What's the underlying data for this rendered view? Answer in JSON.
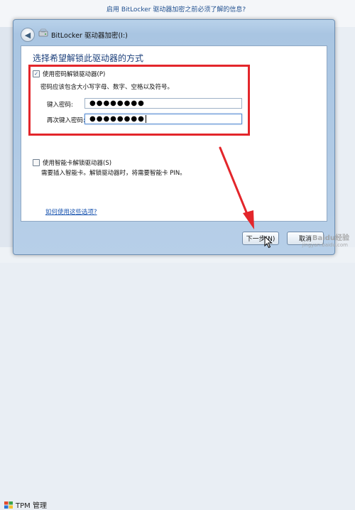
{
  "background": {
    "top_link": "启用 BitLocker 驱动器加密之前必须了解的信息?",
    "taskbar_item": "TPM 管理"
  },
  "window": {
    "title": "BitLocker 驱动器加密(I:)",
    "heading": "选择希望解锁此驱动器的方式",
    "password_option": {
      "checked": true,
      "label": "使用密码解锁驱动器(P)",
      "hint": "密码应该包含大小写字母、数字、空格以及符号。",
      "enter_label": "键入密码:",
      "enter_value": "●●●●●●●●",
      "reenter_label": "再次键入密码:",
      "reenter_value": "●●●●●●●●"
    },
    "smartcard_option": {
      "checked": false,
      "label": "使用智能卡解锁驱动器(S)",
      "hint": "需要插入智能卡。解锁驱动器时，将需要智能卡 PIN。"
    },
    "help_link": "如何使用这些选项?",
    "buttons": {
      "next": "下一步(N)",
      "cancel": "取消"
    }
  },
  "watermark": {
    "text": "Baidu经验",
    "url": "jingyan.baidu.com"
  },
  "colors": {
    "highlight_box": "#e3262b",
    "heading": "#1a3e7a",
    "link": "#1a55b0"
  }
}
